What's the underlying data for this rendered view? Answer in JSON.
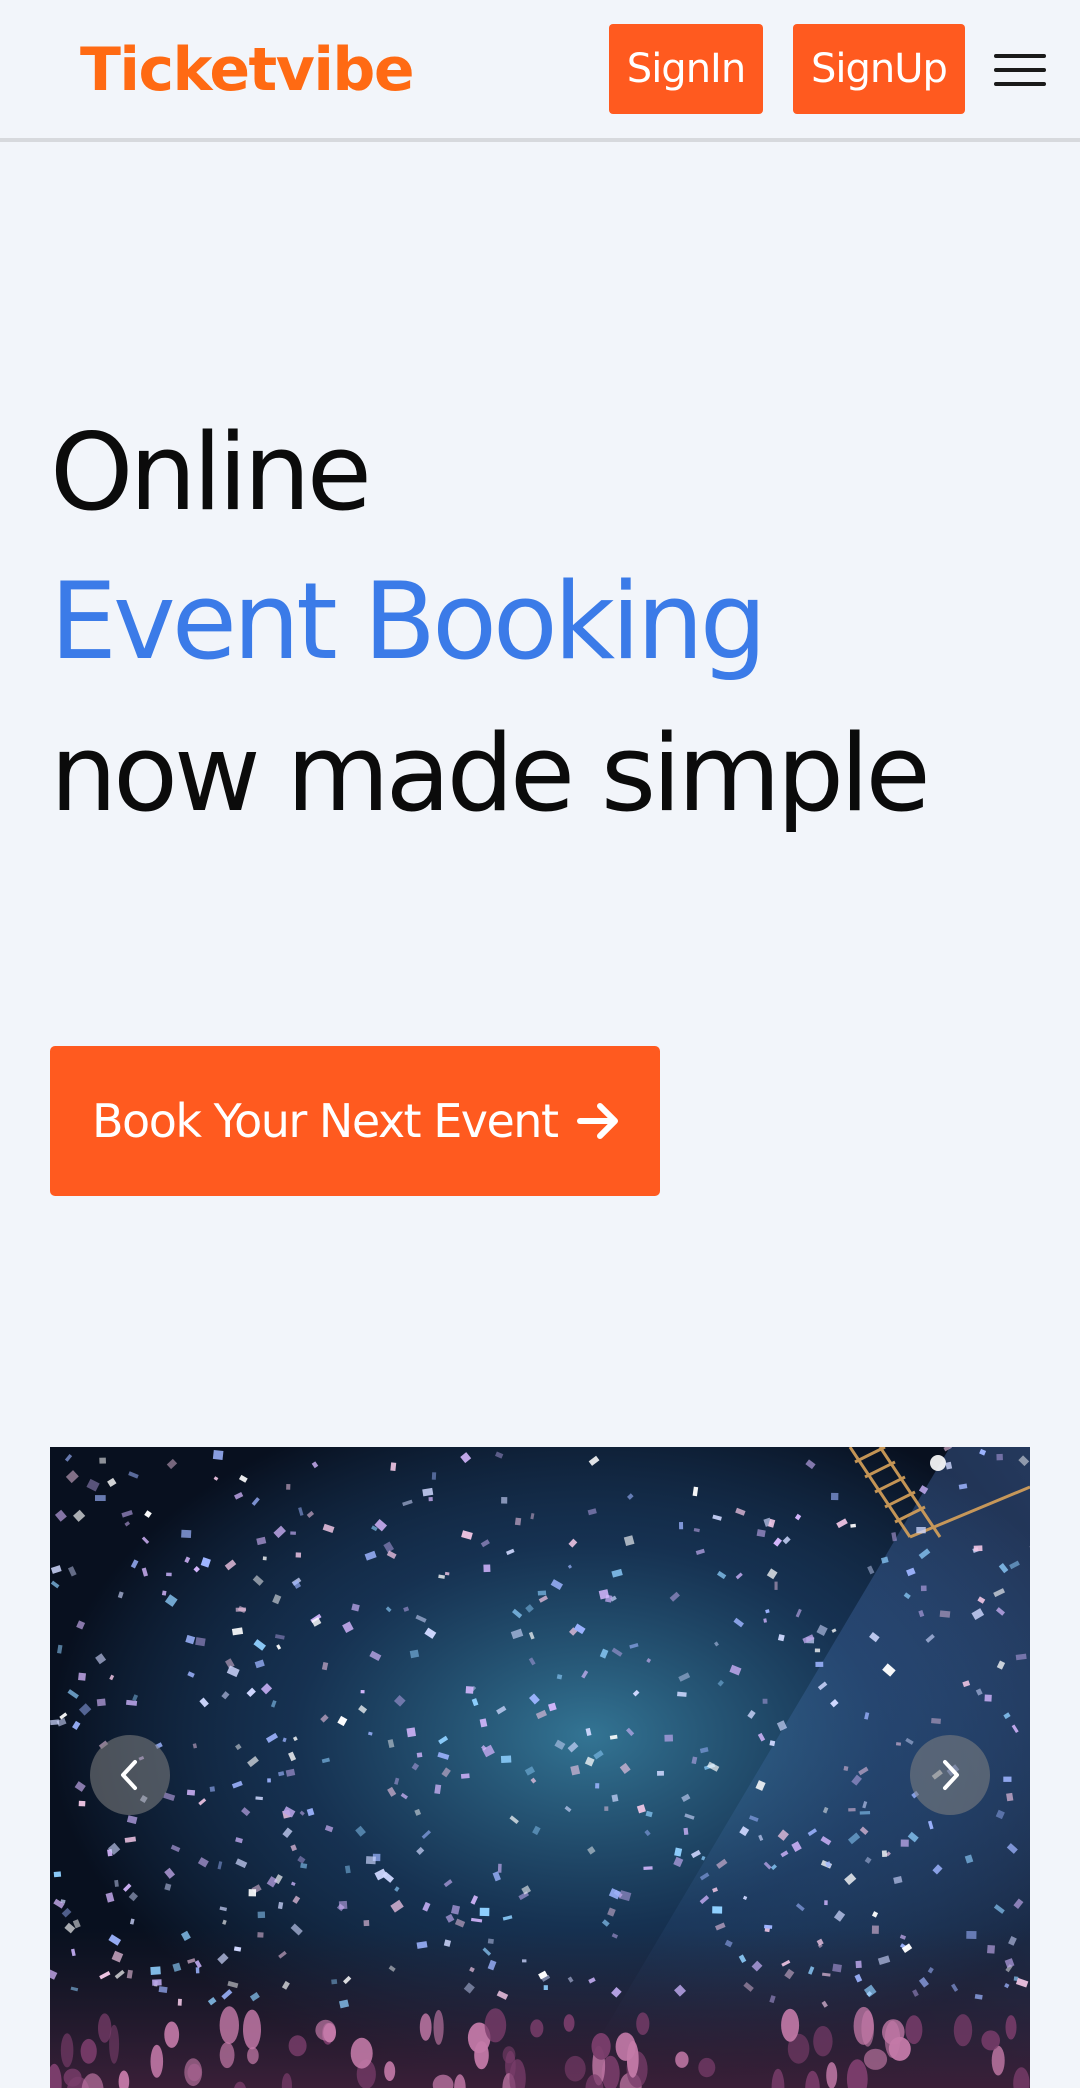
{
  "header": {
    "brand": "Ticketvibe",
    "signin_label": "SignIn",
    "signup_label": "SignUp",
    "menu_icon": "hamburger-menu-icon"
  },
  "hero": {
    "line1": "Online",
    "line2": "Event Booking",
    "line3": "now made simple"
  },
  "cta": {
    "label": "Book Your Next Event",
    "icon": "arrow-right-icon"
  },
  "carousel": {
    "image": "concert-confetti-photo",
    "prev_icon": "chevron-left-icon",
    "next_icon": "chevron-right-icon"
  },
  "colors": {
    "brand": "#ff6a13",
    "button": "#ff5a1f",
    "accent_blue": "#3b7be8",
    "background": "#f2f5fa",
    "text": "#0b0b0b"
  }
}
